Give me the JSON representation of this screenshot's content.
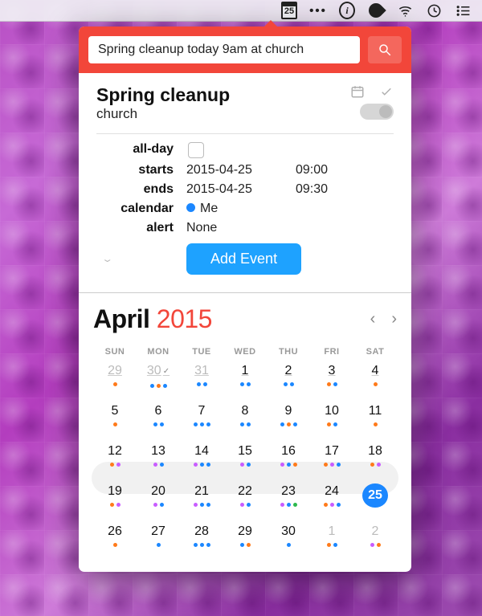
{
  "menubar": {
    "date_badge": "25"
  },
  "input": {
    "value": "Spring cleanup today 9am at church"
  },
  "event": {
    "title": "Spring cleanup",
    "location": "church",
    "labels": {
      "allday": "all-day",
      "starts": "starts",
      "ends": "ends",
      "calendar": "calendar",
      "alert": "alert"
    },
    "start_date": "2015-04-25",
    "start_time": "09:00",
    "end_date": "2015-04-25",
    "end_time": "09:30",
    "calendar_name": "Me",
    "alert": "None",
    "add_button": "Add Event"
  },
  "calendar": {
    "month": "April",
    "year": "2015",
    "dow": [
      "SUN",
      "MON",
      "TUE",
      "WED",
      "THU",
      "FRI",
      "SAT"
    ],
    "days": [
      {
        "n": "29",
        "cls": "prev",
        "ev": [
          "o"
        ]
      },
      {
        "n": "30",
        "cls": "prev",
        "ev": [
          "b",
          "o",
          "b"
        ],
        "tick": true
      },
      {
        "n": "31",
        "cls": "prev",
        "ev": [
          "b",
          "b"
        ]
      },
      {
        "n": "1",
        "cls": "under",
        "ev": [
          "b",
          "b"
        ]
      },
      {
        "n": "2",
        "cls": "under",
        "ev": [
          "b",
          "b"
        ]
      },
      {
        "n": "3",
        "cls": "under",
        "ev": [
          "o",
          "b"
        ]
      },
      {
        "n": "4",
        "cls": "under",
        "ev": [
          "o"
        ]
      },
      {
        "n": "5",
        "ev": [
          "o"
        ]
      },
      {
        "n": "6",
        "ev": [
          "b",
          "b"
        ]
      },
      {
        "n": "7",
        "ev": [
          "b",
          "b",
          "b"
        ]
      },
      {
        "n": "8",
        "ev": [
          "b",
          "b"
        ]
      },
      {
        "n": "9",
        "ev": [
          "b",
          "o",
          "b"
        ]
      },
      {
        "n": "10",
        "ev": [
          "o",
          "b"
        ]
      },
      {
        "n": "11",
        "ev": [
          "o"
        ]
      },
      {
        "n": "12",
        "ev": [
          "o",
          "p"
        ]
      },
      {
        "n": "13",
        "ev": [
          "p",
          "b"
        ]
      },
      {
        "n": "14",
        "ev": [
          "p",
          "b",
          "b"
        ]
      },
      {
        "n": "15",
        "ev": [
          "p",
          "b"
        ]
      },
      {
        "n": "16",
        "ev": [
          "p",
          "b",
          "o"
        ]
      },
      {
        "n": "17",
        "ev": [
          "o",
          "p",
          "b"
        ]
      },
      {
        "n": "18",
        "ev": [
          "o",
          "p"
        ]
      },
      {
        "n": "19",
        "ev": [
          "o",
          "p"
        ]
      },
      {
        "n": "20",
        "ev": [
          "p",
          "b"
        ]
      },
      {
        "n": "21",
        "ev": [
          "p",
          "b",
          "b"
        ]
      },
      {
        "n": "22",
        "ev": [
          "p",
          "b"
        ]
      },
      {
        "n": "23",
        "ev": [
          "p",
          "b",
          "g"
        ]
      },
      {
        "n": "24",
        "ev": [
          "o",
          "p",
          "b"
        ]
      },
      {
        "n": "25",
        "cls": "today",
        "ev": [
          "o",
          "o",
          "o"
        ]
      },
      {
        "n": "26",
        "ev": [
          "o"
        ]
      },
      {
        "n": "27",
        "ev": [
          "b"
        ]
      },
      {
        "n": "28",
        "ev": [
          "b",
          "b",
          "b"
        ]
      },
      {
        "n": "29",
        "ev": [
          "b",
          "o"
        ]
      },
      {
        "n": "30",
        "ev": [
          "b"
        ]
      },
      {
        "n": "1",
        "cls": "next",
        "ev": [
          "o",
          "b"
        ]
      },
      {
        "n": "2",
        "cls": "next",
        "ev": [
          "p",
          "o"
        ]
      }
    ]
  }
}
